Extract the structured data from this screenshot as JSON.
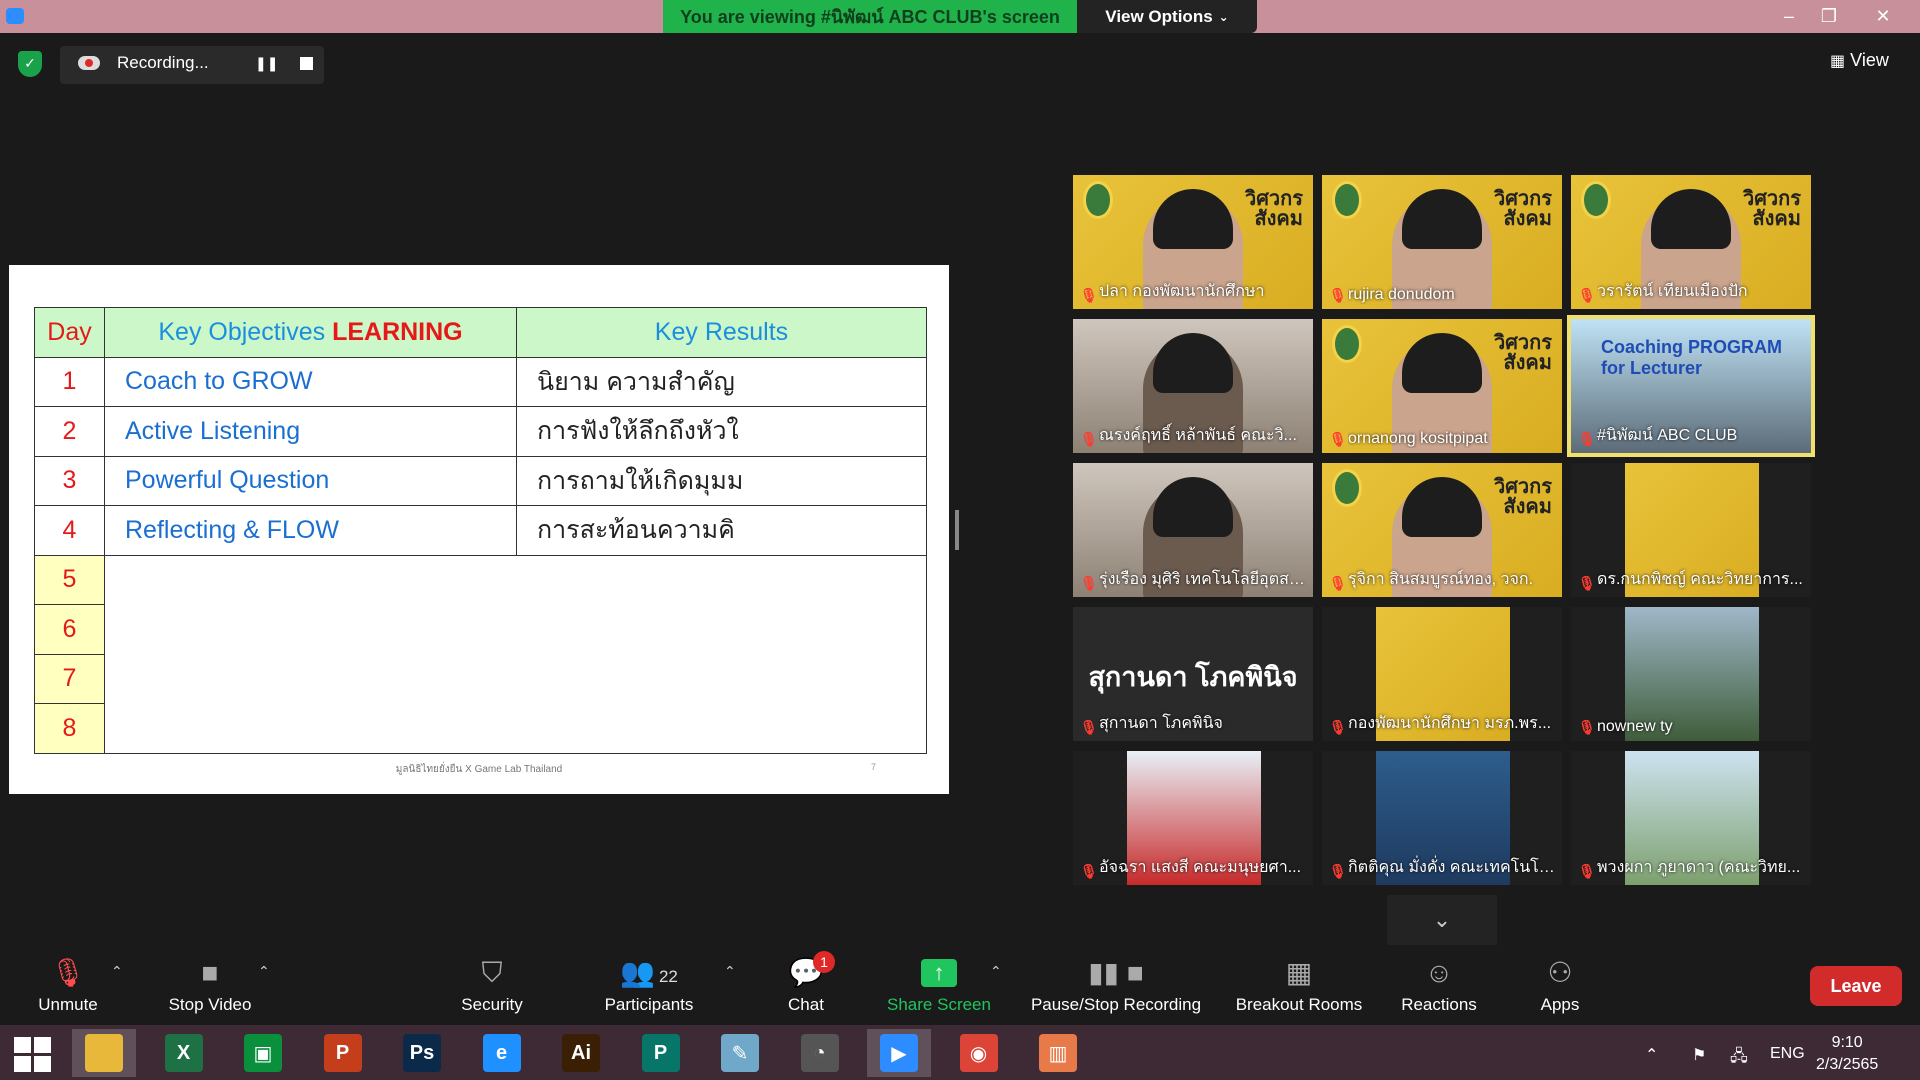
{
  "window": {
    "banner": "You are viewing #นิพัฒน์ ABC CLUB's screen",
    "view_options": "View Options",
    "minimize": "–",
    "restore": "❐",
    "close": "✕"
  },
  "recording": {
    "label": "Recording...",
    "pause": "❚❚"
  },
  "view_button": "View",
  "slide": {
    "headers": {
      "day": "Day",
      "objectives_prefix": "Key Objectives ",
      "objectives_highlight": "LEARNING",
      "results": "Key Results"
    },
    "rows": [
      {
        "day": "1",
        "objective": "Coach to GROW",
        "result": "นิยาม ความสำคัญ"
      },
      {
        "day": "2",
        "objective": "Active Listening",
        "result": "การฟังให้ลึกถึงหัวใ"
      },
      {
        "day": "3",
        "objective": "Powerful Question",
        "result": "การถามให้เกิดมุมม"
      },
      {
        "day": "4",
        "objective": "Reflecting & FLOW",
        "result": "การสะท้อนความคิ"
      }
    ],
    "empty_days": [
      "5",
      "6",
      "7",
      "8"
    ],
    "footer": "มูลนิธิไทยยั่งยืน X Game Lab Thailand",
    "page_number": "7"
  },
  "participants_grid": [
    {
      "name": "ปลา กองพัฒนานักศึกษา",
      "bg": "banner"
    },
    {
      "name": "rujira donudom",
      "bg": "banner"
    },
    {
      "name": "วรารัตน์ เทียนเมืองปัก",
      "bg": "banner"
    },
    {
      "name": "ณรงค์ฤทธิ์ หล้าพันธ์ คณะวิ...",
      "bg": "room"
    },
    {
      "name": "ornanong kositpipat",
      "bg": "banner"
    },
    {
      "name": "#นิพัฒน์ ABC CLUB",
      "bg": "coach",
      "overlay": "Coaching PROGRAM",
      "overlay2": "for Lecturer"
    },
    {
      "name": "รุ่งเรือง มุศิริ เทคโนโลยีอุตสา...",
      "bg": "room"
    },
    {
      "name": "รุจิกา สินสมบูรณ์ทอง, วจก.",
      "bg": "banner"
    },
    {
      "name": "ดร.กนกพิชญ์ คณะวิทยาการ...",
      "bg": "banner-narrow"
    },
    {
      "name": "สุกานดา โภคพินิจ",
      "bg": "dark",
      "bigname": "สุกานดา โภคพินิจ"
    },
    {
      "name": "กองพัฒนานักศึกษา มรภ.พร...",
      "bg": "banner-narrow"
    },
    {
      "name": "nownew ty",
      "bg": "lake"
    },
    {
      "name": "อัจฉรา แสงสี คณะมนุษยศา...",
      "bg": "bird"
    },
    {
      "name": "กิตติคุณ มั่งคั่ง คณะเทคโนโล...",
      "bg": "portrait"
    },
    {
      "name": "พวงผกา ภูยาดาว (คณะวิทย...",
      "bg": "outdoor"
    }
  ],
  "tile_banner_text": "วิศวกร สังคม",
  "scroll_down": "⌄",
  "toolbar": {
    "unmute": "Unmute",
    "stop_video": "Stop Video",
    "security": "Security",
    "participants": "Participants",
    "participants_count": "22",
    "chat": "Chat",
    "chat_badge": "1",
    "share_screen": "Share Screen",
    "pause_stop_recording": "Pause/Stop Recording",
    "breakout_rooms": "Breakout Rooms",
    "reactions": "Reactions",
    "apps": "Apps",
    "leave": "Leave"
  },
  "taskbar": {
    "apps": [
      {
        "name": "file-explorer",
        "label": "",
        "color": "#e8b83a"
      },
      {
        "name": "excel",
        "label": "X",
        "color": "#1e7145"
      },
      {
        "name": "store",
        "label": "▣",
        "color": "#0a8f3c"
      },
      {
        "name": "powerpoint",
        "label": "P",
        "color": "#c43e1c"
      },
      {
        "name": "photoshop",
        "label": "Ps",
        "color": "#0b2a4a"
      },
      {
        "name": "internet-explorer",
        "label": "e",
        "color": "#1e90ff"
      },
      {
        "name": "illustrator",
        "label": "Ai",
        "color": "#3a1f05"
      },
      {
        "name": "publisher",
        "label": "P",
        "color": "#077568"
      },
      {
        "name": "notes",
        "label": "✎",
        "color": "#6fa8c8"
      },
      {
        "name": "photoscape",
        "label": "◔",
        "color": "#555"
      },
      {
        "name": "zoom",
        "label": "▶",
        "color": "#2d8cff"
      },
      {
        "name": "chrome",
        "label": "◉",
        "color": "#db4437"
      },
      {
        "name": "presentation-app",
        "label": "▥",
        "color": "#e87a4a"
      }
    ],
    "language": "ENG",
    "time": "9:10",
    "date": "2/3/2565"
  },
  "colors": {
    "banner": "#21b34b",
    "leave": "#d12b2b",
    "share": "#21c55d",
    "mute": "#ff3b30"
  }
}
